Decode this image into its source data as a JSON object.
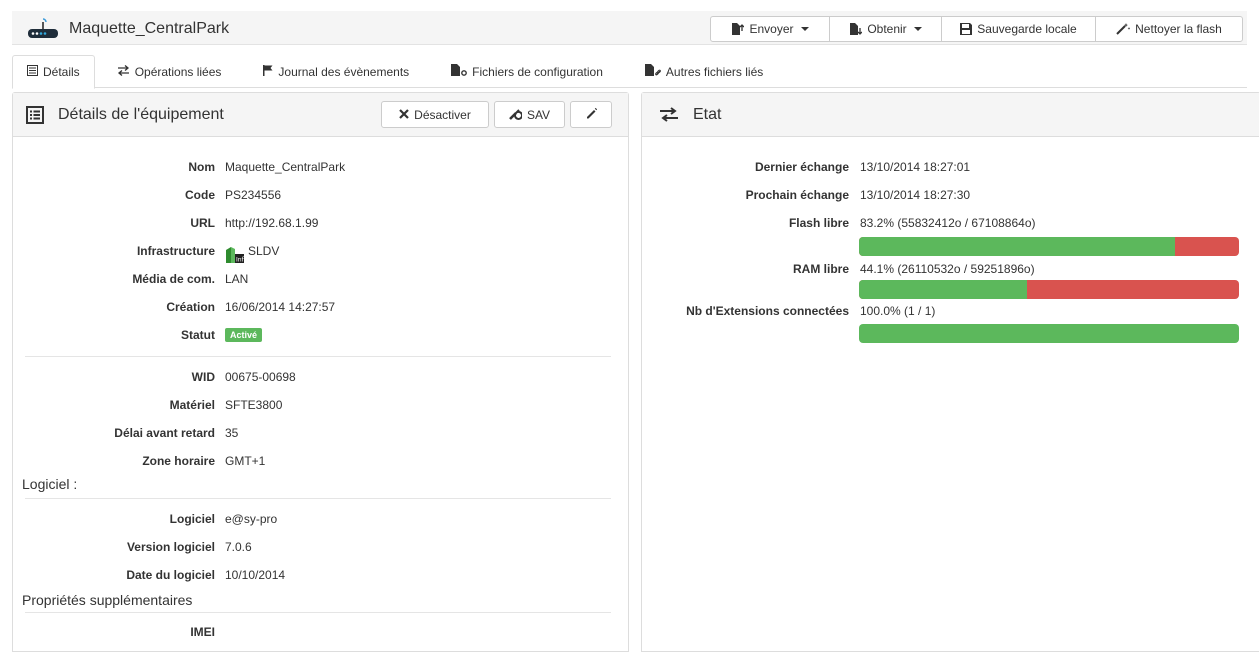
{
  "header": {
    "title": "Maquette_CentralPark",
    "buttons": {
      "envoyer": "Envoyer",
      "obtenir": "Obtenir",
      "sauvegarde": "Sauvegarde locale",
      "nettoyer": "Nettoyer la flash"
    }
  },
  "tabs": [
    {
      "label": "Détails",
      "icon": "list-icon"
    },
    {
      "label": "Opérations liées",
      "icon": "exchange-icon"
    },
    {
      "label": "Journal des évènements",
      "icon": "flag-icon"
    },
    {
      "label": "Fichiers de configuration",
      "icon": "file-gear-icon"
    },
    {
      "label": "Autres fichiers liés",
      "icon": "file-link-icon"
    }
  ],
  "details": {
    "title": "Détails de l'équipement",
    "buttons": {
      "desactiver": "Désactiver",
      "sav": "SAV"
    },
    "fields": {
      "nom": {
        "label": "Nom",
        "value": "Maquette_CentralPark"
      },
      "code": {
        "label": "Code",
        "value": "PS234556"
      },
      "url": {
        "label": "URL",
        "value": "http://192.68.1.99"
      },
      "infrastructure": {
        "label": "Infrastructure",
        "value": "SLDV"
      },
      "media": {
        "label": "Média de com.",
        "value": "LAN"
      },
      "creation": {
        "label": "Création",
        "value": "16/06/2014 14:27:57"
      },
      "statut": {
        "label": "Statut",
        "value": "Activé"
      },
      "wid": {
        "label": "WID",
        "value": "00675-00698"
      },
      "materiel": {
        "label": "Matériel",
        "value": "SFTE3800"
      },
      "delai": {
        "label": "Délai avant retard",
        "value": "35"
      },
      "zone": {
        "label": "Zone horaire",
        "value": "GMT+1"
      }
    },
    "logiciel_section": "Logiciel :",
    "logiciel": {
      "logiciel": {
        "label": "Logiciel",
        "value": "e@sy-pro"
      },
      "version": {
        "label": "Version logiciel",
        "value": "7.0.6"
      },
      "date": {
        "label": "Date du logiciel",
        "value": "10/10/2014"
      }
    },
    "props_section": "Propriétés supplémentaires",
    "props": {
      "imei": {
        "label": "IMEI",
        "value": ""
      }
    }
  },
  "etat": {
    "title": "Etat",
    "dernier": {
      "label": "Dernier échange",
      "value": "13/10/2014 18:27:01"
    },
    "prochain": {
      "label": "Prochain échange",
      "value": "13/10/2014 18:27:30"
    },
    "flash": {
      "label": "Flash libre",
      "value": "83.2% (55832412o / 67108864o)",
      "percent": 83.2
    },
    "ram": {
      "label": "RAM libre",
      "value": "44.1% (26110532o / 59251896o)",
      "percent": 44.1
    },
    "ext": {
      "label": "Nb d'Extensions connectées",
      "value": "100.0% (1 / 1)",
      "percent": 100.0
    }
  },
  "colors": {
    "success": "#5cb85c",
    "danger": "#d9534f"
  }
}
